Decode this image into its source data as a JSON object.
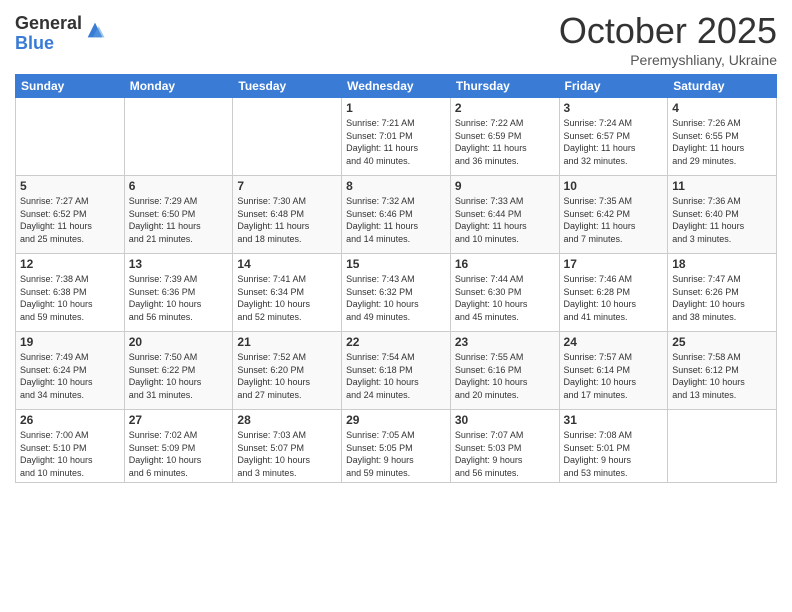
{
  "header": {
    "logo_general": "General",
    "logo_blue": "Blue",
    "month": "October 2025",
    "location": "Peremyshliany, Ukraine"
  },
  "weekdays": [
    "Sunday",
    "Monday",
    "Tuesday",
    "Wednesday",
    "Thursday",
    "Friday",
    "Saturday"
  ],
  "weeks": [
    [
      {
        "day": "",
        "info": ""
      },
      {
        "day": "",
        "info": ""
      },
      {
        "day": "",
        "info": ""
      },
      {
        "day": "1",
        "info": "Sunrise: 7:21 AM\nSunset: 7:01 PM\nDaylight: 11 hours\nand 40 minutes."
      },
      {
        "day": "2",
        "info": "Sunrise: 7:22 AM\nSunset: 6:59 PM\nDaylight: 11 hours\nand 36 minutes."
      },
      {
        "day": "3",
        "info": "Sunrise: 7:24 AM\nSunset: 6:57 PM\nDaylight: 11 hours\nand 32 minutes."
      },
      {
        "day": "4",
        "info": "Sunrise: 7:26 AM\nSunset: 6:55 PM\nDaylight: 11 hours\nand 29 minutes."
      }
    ],
    [
      {
        "day": "5",
        "info": "Sunrise: 7:27 AM\nSunset: 6:52 PM\nDaylight: 11 hours\nand 25 minutes."
      },
      {
        "day": "6",
        "info": "Sunrise: 7:29 AM\nSunset: 6:50 PM\nDaylight: 11 hours\nand 21 minutes."
      },
      {
        "day": "7",
        "info": "Sunrise: 7:30 AM\nSunset: 6:48 PM\nDaylight: 11 hours\nand 18 minutes."
      },
      {
        "day": "8",
        "info": "Sunrise: 7:32 AM\nSunset: 6:46 PM\nDaylight: 11 hours\nand 14 minutes."
      },
      {
        "day": "9",
        "info": "Sunrise: 7:33 AM\nSunset: 6:44 PM\nDaylight: 11 hours\nand 10 minutes."
      },
      {
        "day": "10",
        "info": "Sunrise: 7:35 AM\nSunset: 6:42 PM\nDaylight: 11 hours\nand 7 minutes."
      },
      {
        "day": "11",
        "info": "Sunrise: 7:36 AM\nSunset: 6:40 PM\nDaylight: 11 hours\nand 3 minutes."
      }
    ],
    [
      {
        "day": "12",
        "info": "Sunrise: 7:38 AM\nSunset: 6:38 PM\nDaylight: 10 hours\nand 59 minutes."
      },
      {
        "day": "13",
        "info": "Sunrise: 7:39 AM\nSunset: 6:36 PM\nDaylight: 10 hours\nand 56 minutes."
      },
      {
        "day": "14",
        "info": "Sunrise: 7:41 AM\nSunset: 6:34 PM\nDaylight: 10 hours\nand 52 minutes."
      },
      {
        "day": "15",
        "info": "Sunrise: 7:43 AM\nSunset: 6:32 PM\nDaylight: 10 hours\nand 49 minutes."
      },
      {
        "day": "16",
        "info": "Sunrise: 7:44 AM\nSunset: 6:30 PM\nDaylight: 10 hours\nand 45 minutes."
      },
      {
        "day": "17",
        "info": "Sunrise: 7:46 AM\nSunset: 6:28 PM\nDaylight: 10 hours\nand 41 minutes."
      },
      {
        "day": "18",
        "info": "Sunrise: 7:47 AM\nSunset: 6:26 PM\nDaylight: 10 hours\nand 38 minutes."
      }
    ],
    [
      {
        "day": "19",
        "info": "Sunrise: 7:49 AM\nSunset: 6:24 PM\nDaylight: 10 hours\nand 34 minutes."
      },
      {
        "day": "20",
        "info": "Sunrise: 7:50 AM\nSunset: 6:22 PM\nDaylight: 10 hours\nand 31 minutes."
      },
      {
        "day": "21",
        "info": "Sunrise: 7:52 AM\nSunset: 6:20 PM\nDaylight: 10 hours\nand 27 minutes."
      },
      {
        "day": "22",
        "info": "Sunrise: 7:54 AM\nSunset: 6:18 PM\nDaylight: 10 hours\nand 24 minutes."
      },
      {
        "day": "23",
        "info": "Sunrise: 7:55 AM\nSunset: 6:16 PM\nDaylight: 10 hours\nand 20 minutes."
      },
      {
        "day": "24",
        "info": "Sunrise: 7:57 AM\nSunset: 6:14 PM\nDaylight: 10 hours\nand 17 minutes."
      },
      {
        "day": "25",
        "info": "Sunrise: 7:58 AM\nSunset: 6:12 PM\nDaylight: 10 hours\nand 13 minutes."
      }
    ],
    [
      {
        "day": "26",
        "info": "Sunrise: 7:00 AM\nSunset: 5:10 PM\nDaylight: 10 hours\nand 10 minutes."
      },
      {
        "day": "27",
        "info": "Sunrise: 7:02 AM\nSunset: 5:09 PM\nDaylight: 10 hours\nand 6 minutes."
      },
      {
        "day": "28",
        "info": "Sunrise: 7:03 AM\nSunset: 5:07 PM\nDaylight: 10 hours\nand 3 minutes."
      },
      {
        "day": "29",
        "info": "Sunrise: 7:05 AM\nSunset: 5:05 PM\nDaylight: 9 hours\nand 59 minutes."
      },
      {
        "day": "30",
        "info": "Sunrise: 7:07 AM\nSunset: 5:03 PM\nDaylight: 9 hours\nand 56 minutes."
      },
      {
        "day": "31",
        "info": "Sunrise: 7:08 AM\nSunset: 5:01 PM\nDaylight: 9 hours\nand 53 minutes."
      },
      {
        "day": "",
        "info": ""
      }
    ]
  ]
}
